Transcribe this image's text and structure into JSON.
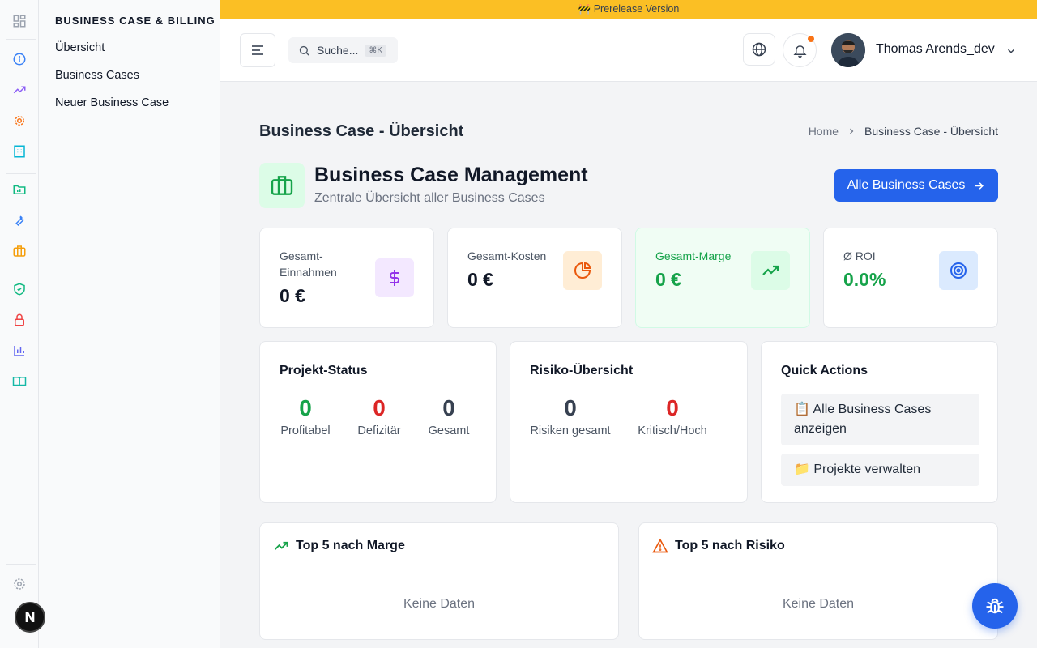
{
  "banner": {
    "text": "🚧 Prerelease Version"
  },
  "rail": {
    "icons": [
      "dashboard-icon",
      "info-icon",
      "trending-icon",
      "cog-icon",
      "building-icon",
      "folder-chart-icon",
      "wrench-icon",
      "briefcase-icon",
      "shield-check-icon",
      "lock-icon",
      "bar-chart-icon",
      "book-icon",
      "settings-icon"
    ],
    "badge": "N"
  },
  "sidebar": {
    "section_title": "BUSINESS CASE & BILLING",
    "items": [
      {
        "label": "Übersicht"
      },
      {
        "label": "Business Cases"
      },
      {
        "label": "Neuer Business Case"
      }
    ]
  },
  "header": {
    "search_placeholder": "Suche...",
    "search_shortcut": "⌘K",
    "user_name": "Thomas Arends_dev"
  },
  "page": {
    "title": "Business Case - Übersicht",
    "breadcrumb": {
      "home": "Home",
      "current": "Business Case - Übersicht"
    }
  },
  "hero": {
    "title": "Business Case Management",
    "subtitle": "Zentrale Übersicht aller Business Cases",
    "button_label": "Alle Business Cases"
  },
  "stats": [
    {
      "label": "Gesamt-Einnahmen",
      "value": "0 €",
      "icon": "dollar-icon",
      "color": "#9333ea",
      "bg": "#f3e8ff"
    },
    {
      "label": "Gesamt-Kosten",
      "value": "0 €",
      "icon": "pie-chart-icon",
      "color": "#ea580c",
      "bg": "#ffedd5"
    },
    {
      "label": "Gesamt-Marge",
      "value": "0 €",
      "icon": "trending-up-icon",
      "color": "#16a34a",
      "bg": "#dcfce7"
    },
    {
      "label": "Ø ROI",
      "value": "0.0%",
      "icon": "target-icon",
      "color": "#2563eb",
      "bg": "#dbeafe"
    }
  ],
  "project_status": {
    "title": "Projekt-Status",
    "metrics": [
      {
        "value": "0",
        "label": "Profitabel",
        "color": "#16a34a"
      },
      {
        "value": "0",
        "label": "Defizitär",
        "color": "#dc2626"
      },
      {
        "value": "0",
        "label": "Gesamt",
        "color": "#374151"
      }
    ]
  },
  "risk_overview": {
    "title": "Risiko-Übersicht",
    "metrics": [
      {
        "value": "0",
        "label": "Risiken gesamt",
        "color": "#374151"
      },
      {
        "value": "0",
        "label": "Kritisch/Hoch",
        "color": "#dc2626"
      }
    ]
  },
  "quick_actions": {
    "title": "Quick Actions",
    "items": [
      {
        "label": "📋 Alle Business Cases anzeigen"
      },
      {
        "label": "📁 Projekte verwalten"
      }
    ]
  },
  "top_margin": {
    "title": "Top 5 nach Marge",
    "empty": "Keine Daten"
  },
  "top_risk": {
    "title": "Top 5 nach Risiko",
    "empty": "Keine Daten"
  }
}
